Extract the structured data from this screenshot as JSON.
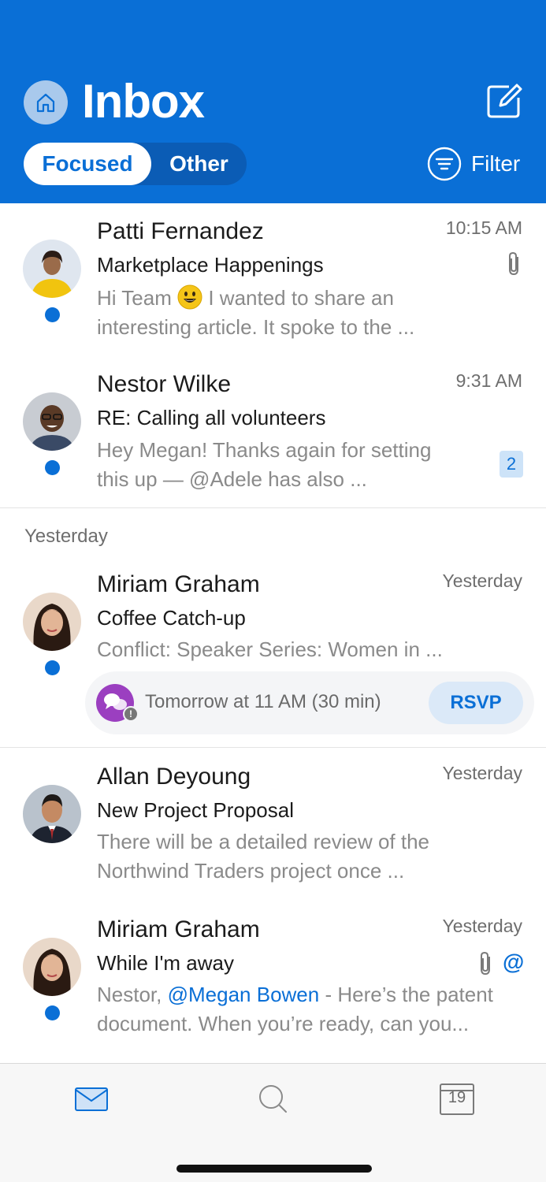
{
  "header": {
    "title": "Inbox",
    "tabs": {
      "focused": "Focused",
      "other": "Other"
    },
    "filter_label": "Filter",
    "accent_color": "#0a6fd6",
    "icons": {
      "home": "home-icon",
      "compose": "compose-icon",
      "filter": "filter-icon"
    }
  },
  "emails": [
    {
      "sender": "Patti Fernandez",
      "time": "10:15 AM",
      "subject": "Marketplace Happenings",
      "preview_before_emoji": "Hi Team",
      "preview_after_emoji": "I wanted to share an interesting article. It spoke to the ...",
      "has_attachment": true,
      "unread": true
    },
    {
      "sender": "Nestor Wilke",
      "time": "9:31 AM",
      "subject": "RE: Calling all volunteers",
      "preview": "Hey Megan! Thanks again for setting this up — @Adele has also ...",
      "thread_count": "2",
      "unread": true
    }
  ],
  "section_yesterday": "Yesterday",
  "emails_yesterday": [
    {
      "sender": "Miriam Graham",
      "time": "Yesterday",
      "subject": "Coffee Catch-up",
      "preview": "Conflict: Speaker Series: Women in ...",
      "event_text": "Tomorrow at 11 AM (30 min)",
      "rsvp_label": "RSVP",
      "unread": true
    },
    {
      "sender": "Allan Deyoung",
      "time": "Yesterday",
      "subject": "New Project Proposal",
      "preview": "There will be a detailed review of the Northwind Traders project once ...",
      "unread": false
    },
    {
      "sender": "Miriam Graham",
      "time": "Yesterday",
      "subject": "While I'm away",
      "preview_prefix": "Nestor,",
      "preview_mention": "@Megan Bowen",
      "preview_suffix": "- Here’s the patent document. When you’re ready, can you...",
      "has_attachment": true,
      "mentions_me": "@",
      "unread": true
    }
  ],
  "tabbar": {
    "mail_icon": "mail-icon",
    "search_icon": "search-icon",
    "calendar_icon": "calendar-icon",
    "calendar_day": "19"
  }
}
